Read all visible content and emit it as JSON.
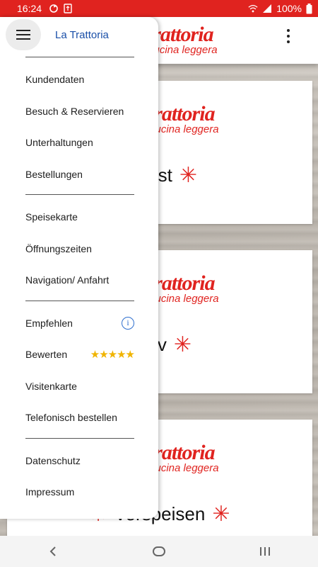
{
  "status_bar": {
    "time": "16:24",
    "battery": "100%",
    "background_color": "#e0231f"
  },
  "app": {
    "brand_color": "#e0231f",
    "logo_text": "Trattoria",
    "logo_subtext": "cucina leggera"
  },
  "drawer": {
    "title": "La Trattoria",
    "sections": [
      [
        "Kundendaten",
        "Besuch & Reservieren",
        "Unterhaltungen",
        "Bestellungen"
      ],
      [
        "Speisekarte",
        "Öffnungszeiten",
        "Navigation/ Anfahrt"
      ],
      [
        "Empfehlen",
        "Bewerten",
        "Visitenkarte",
        "Telefonisch bestellen"
      ],
      [
        "Datenschutz",
        "Impressum"
      ]
    ],
    "items": {
      "kundendaten": "Kundendaten",
      "besuch": "Besuch & Reservieren",
      "unterhaltungen": "Unterhaltungen",
      "bestellungen": "Bestellungen",
      "speisekarte": "Speisekarte",
      "oeffnungszeiten": "Öffnungszeiten",
      "navigation": "Navigation/ Anfahrt",
      "empfehlen": "Empfehlen",
      "bewerten": "Bewerten",
      "visitenkarte": "Visitenkarte",
      "telefonisch": "Telefonisch bestellen",
      "datenschutz": "Datenschutz",
      "impressum": "Impressum"
    },
    "rating_stars": "★★★★★",
    "rating_value": 5,
    "info_glyph": "i"
  },
  "cards": {
    "card1_title": "r Gast",
    "card2_title": "eritiv",
    "card3_title": "Vorspeisen",
    "asterisk": "✳"
  },
  "icons": {
    "hamburger": "menu-icon",
    "overflow": "more-vert-icon",
    "info": "info-icon",
    "back": "back-icon",
    "home": "home-icon",
    "recents": "recents-icon"
  }
}
